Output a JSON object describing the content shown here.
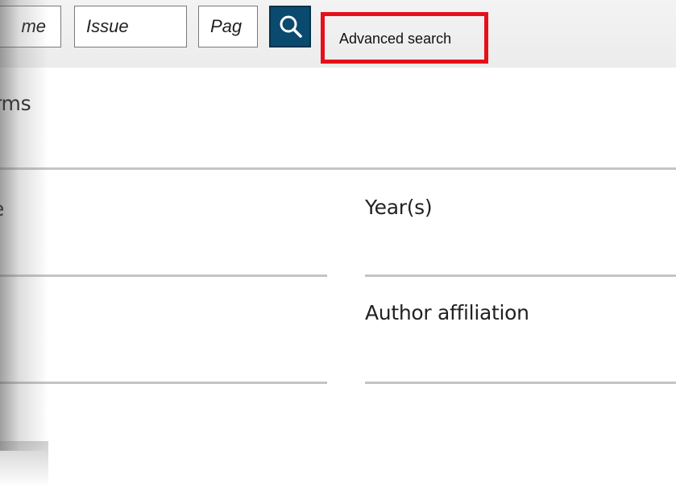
{
  "search": {
    "volume_fragment": "me",
    "issue_placeholder": "Issue",
    "page_fragment": "Pag",
    "search_icon": "search-icon",
    "advanced_search_label": "Advanced search",
    "highlight_color": "#e5101a",
    "button_color": "#0a4a6e"
  },
  "form": {
    "terms_label_fragment": "rms",
    "type_label_fragment": "e",
    "years_label": "Year(s)",
    "affiliation_label": "Author affiliation"
  }
}
